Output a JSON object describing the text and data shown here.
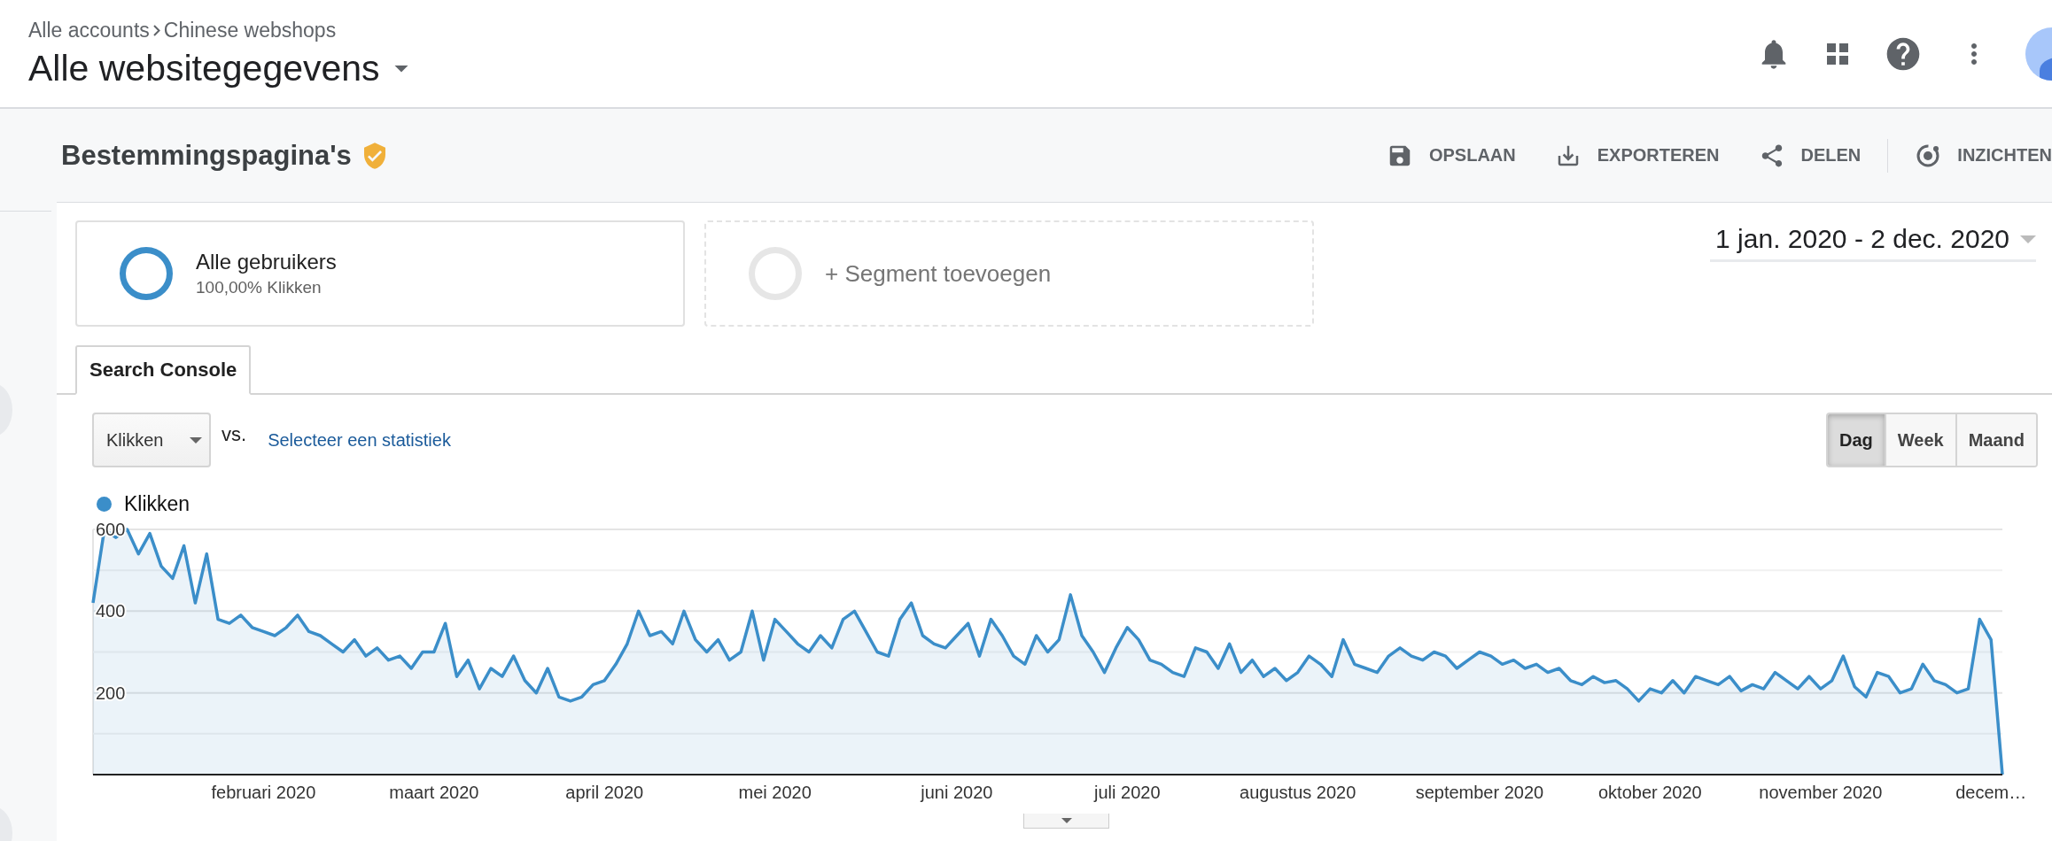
{
  "header": {
    "breadcrumb": [
      "Alle accounts",
      "Chinese webshops"
    ],
    "title": "Alle websitegegevens"
  },
  "report": {
    "title": "Bestemmingspagina's",
    "actions": [
      {
        "label": "OPSLAAN",
        "kind": "save"
      },
      {
        "label": "EXPORTEREN",
        "kind": "export"
      },
      {
        "label": "DELEN",
        "kind": "share"
      },
      {
        "label": "INZICHTEN",
        "kind": "insights"
      }
    ]
  },
  "segments": [
    {
      "kind": "active",
      "name": "Alle gebruikers",
      "detail": "100,00% Klikken"
    },
    {
      "kind": "add",
      "name": "+ Segment toevoegen"
    }
  ],
  "date_range": "1 jan. 2020 - 2 dec. 2020",
  "tabs": [
    {
      "label": "Search Console",
      "selected": true
    }
  ],
  "metric_select": {
    "value": "Klikken"
  },
  "vs": "vs.",
  "compare_link": "Selecteer een statistiek",
  "granularity": [
    {
      "label": "Dag",
      "selected": true
    },
    {
      "label": "Week",
      "selected": false
    },
    {
      "label": "Maand",
      "selected": false
    }
  ],
  "chart": {
    "chart_data": {
      "type": "area",
      "ylim": [
        0,
        600
      ],
      "yticks": [
        200,
        400,
        600
      ],
      "categories": [
        null,
        null,
        null,
        null,
        null,
        null,
        null,
        null,
        null,
        null,
        null,
        null,
        null,
        null,
        null,
        "februari 2020",
        null,
        null,
        null,
        null,
        null,
        null,
        null,
        null,
        null,
        null,
        null,
        null,
        null,
        null,
        "maart 2020",
        null,
        null,
        null,
        null,
        null,
        null,
        null,
        null,
        null,
        null,
        null,
        null,
        null,
        null,
        "april 2020",
        null,
        null,
        null,
        null,
        null,
        null,
        null,
        null,
        null,
        null,
        null,
        null,
        null,
        null,
        "mei 2020",
        null,
        null,
        null,
        null,
        null,
        null,
        null,
        null,
        null,
        null,
        null,
        null,
        null,
        null,
        null,
        "juni 2020",
        null,
        null,
        null,
        null,
        null,
        null,
        null,
        null,
        null,
        null,
        null,
        null,
        null,
        null,
        "juli 2020",
        null,
        null,
        null,
        null,
        null,
        null,
        null,
        null,
        null,
        null,
        null,
        null,
        null,
        null,
        "augustus 2020",
        null,
        null,
        null,
        null,
        null,
        null,
        null,
        null,
        null,
        null,
        null,
        null,
        null,
        null,
        null,
        "september 2020",
        null,
        null,
        null,
        null,
        null,
        null,
        null,
        null,
        null,
        null,
        null,
        null,
        null,
        null,
        "oktober 2020",
        null,
        null,
        null,
        null,
        null,
        null,
        null,
        null,
        null,
        null,
        null,
        null,
        null,
        null,
        "november 2020",
        null,
        null,
        null,
        null,
        null,
        null,
        null,
        null,
        null,
        null,
        null,
        null,
        null,
        null,
        "decem…",
        null
      ],
      "series": [
        {
          "name": "Klikken",
          "color": "#3b8ec9",
          "values": [
            420,
            600,
            580,
            600,
            540,
            590,
            510,
            480,
            560,
            420,
            540,
            380,
            370,
            390,
            360,
            350,
            340,
            360,
            390,
            350,
            340,
            320,
            300,
            330,
            290,
            310,
            280,
            290,
            260,
            300,
            300,
            370,
            240,
            280,
            210,
            260,
            240,
            290,
            230,
            200,
            260,
            190,
            180,
            190,
            220,
            230,
            270,
            320,
            400,
            340,
            350,
            320,
            400,
            330,
            300,
            330,
            280,
            300,
            400,
            280,
            380,
            350,
            320,
            300,
            340,
            310,
            380,
            400,
            350,
            300,
            290,
            380,
            420,
            340,
            320,
            310,
            340,
            370,
            290,
            380,
            340,
            290,
            270,
            340,
            300,
            330,
            440,
            340,
            300,
            250,
            310,
            360,
            330,
            280,
            270,
            250,
            240,
            310,
            300,
            260,
            320,
            250,
            280,
            240,
            260,
            230,
            250,
            290,
            270,
            240,
            330,
            270,
            260,
            250,
            290,
            310,
            290,
            280,
            300,
            290,
            260,
            280,
            300,
            290,
            270,
            280,
            260,
            270,
            250,
            260,
            230,
            220,
            240,
            225,
            230,
            210,
            180,
            210,
            200,
            230,
            200,
            240,
            230,
            220,
            240,
            205,
            220,
            210,
            250,
            230,
            210,
            240,
            210,
            230,
            290,
            215,
            190,
            250,
            240,
            200,
            210,
            270,
            230,
            220,
            200,
            210,
            380,
            330,
            0
          ]
        }
      ]
    }
  }
}
